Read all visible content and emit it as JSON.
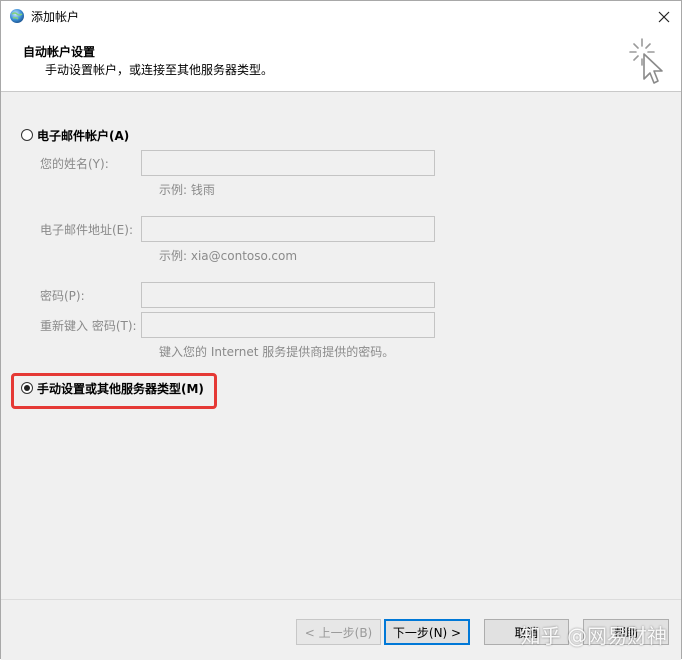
{
  "window": {
    "title": "添加帐户",
    "close_icon": "close-icon",
    "app_icon": "outlook-globe-icon"
  },
  "header": {
    "title": "自动帐户设置",
    "subtitle": "手动设置帐户，或连接至其他服务器类型。",
    "icon": "wizard-cursor-icon"
  },
  "options": {
    "email_account": {
      "label": "电子邮件帐户(A)",
      "checked": false
    },
    "manual": {
      "label": "手动设置或其他服务器类型(M)",
      "checked": true
    }
  },
  "fields": {
    "name": {
      "label": "您的姓名(Y):",
      "value": "",
      "hint": "示例: 钱雨"
    },
    "email": {
      "label": "电子邮件地址(E):",
      "value": "",
      "hint": "示例: xia@contoso.com"
    },
    "password": {
      "label": "密码(P):",
      "value": ""
    },
    "password_retype": {
      "label": "重新键入 密码(T):",
      "value": ""
    },
    "password_hint": "键入您的 Internet 服务提供商提供的密码。"
  },
  "buttons": {
    "back": "< 上一步(B)",
    "next": "下一步(N) >",
    "cancel": "取消",
    "help": "帮助"
  },
  "watermark": "知乎 @网易财神",
  "colors": {
    "highlight": "#e53935",
    "default_button_border": "#0078d7",
    "content_bg": "#f0f0f0"
  }
}
